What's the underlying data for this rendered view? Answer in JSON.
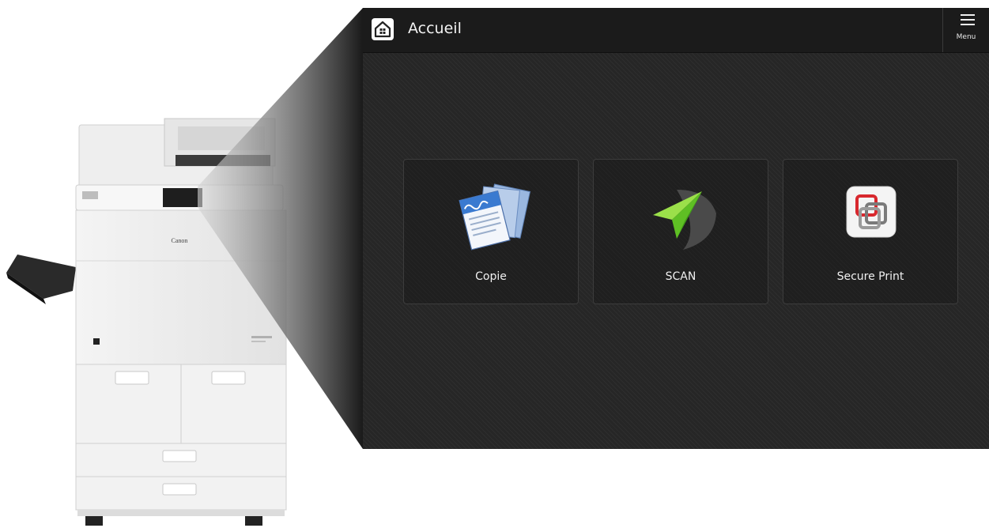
{
  "header": {
    "title": "Accueil",
    "home_icon": "home-icon",
    "menu_label": "Menu",
    "menu_icon": "hamburger-icon"
  },
  "tiles": [
    {
      "label": "Copie",
      "icon": "copy-documents-icon"
    },
    {
      "label": "SCAN",
      "icon": "paper-plane-icon"
    },
    {
      "label": "Secure Print",
      "icon": "secure-print-icon"
    }
  ],
  "printer": {
    "brand": "Canon"
  },
  "colors": {
    "panel_background": "#262626",
    "topbar_background": "#1b1b1b",
    "scan_green": "#7fd62f",
    "secure_red": "#d8282e"
  }
}
